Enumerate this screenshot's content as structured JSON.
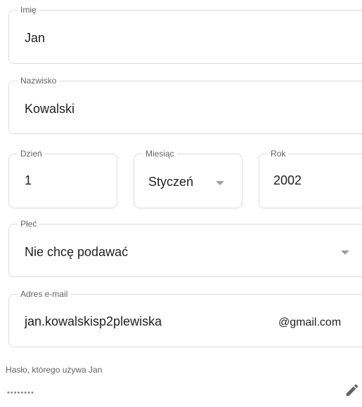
{
  "first_name": {
    "label": "Imię",
    "value": "Jan"
  },
  "last_name": {
    "label": "Nazwisko",
    "value": "Kowalski"
  },
  "birth_day": {
    "label": "Dzień",
    "value": "1"
  },
  "birth_month": {
    "label": "Miesiąc",
    "value": "Styczeń"
  },
  "birth_year": {
    "label": "Rok",
    "value": "2002"
  },
  "gender": {
    "label": "Płeć",
    "value": "Nie chcę podawać"
  },
  "email": {
    "label": "Adres e-mail",
    "value": "jan.kowalskisp2plewiska",
    "suffix": "@gmail.com"
  },
  "password": {
    "label": "Hasło, którego używa Jan",
    "masked": "••••••••"
  },
  "icons": {
    "edit": "pencil-icon",
    "dropdown": "arrow-drop-down-icon"
  },
  "colors": {
    "border": "#dadce0",
    "label": "#5f6368",
    "text": "#202124",
    "arrow": "#9aa0a6"
  }
}
